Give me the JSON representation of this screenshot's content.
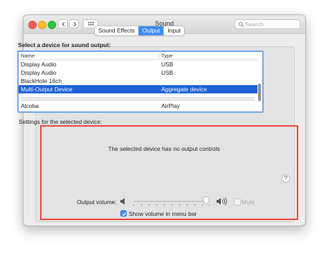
{
  "window": {
    "title": "Sound"
  },
  "search": {
    "placeholder": "Search"
  },
  "tabs": [
    {
      "label": "Sound Effects",
      "active": false
    },
    {
      "label": "Output",
      "active": true
    },
    {
      "label": "Input",
      "active": false
    }
  ],
  "output": {
    "section_label": "Select a device for sound output:",
    "columns": {
      "name": "Name",
      "type": "Type"
    },
    "rows": [
      {
        "name": "Display Audio",
        "type": "USB",
        "selected": false
      },
      {
        "name": "Display Audio",
        "type": "USB",
        "selected": false
      },
      {
        "name": "BlackHole 16ch",
        "type": "",
        "selected": false
      },
      {
        "name": "Multi-Output Device",
        "type": "Aggregate device",
        "selected": true
      },
      {
        "name": "Alcoba",
        "type": "AirPlay",
        "selected": false
      }
    ],
    "settings_label": "Settings for the selected device:",
    "no_controls_text": "The selected device has no output controls",
    "help_label": "?"
  },
  "volume": {
    "label": "Output volume:",
    "level": 0.95,
    "mute_label": "Mute",
    "mute_checked": false,
    "show_in_menu_label": "Show volume in menu bar",
    "show_in_menu_checked": true
  },
  "colors": {
    "accent": "#3e8bf6",
    "selection": "#1d62d5",
    "highlight_box": "#ea4335"
  }
}
